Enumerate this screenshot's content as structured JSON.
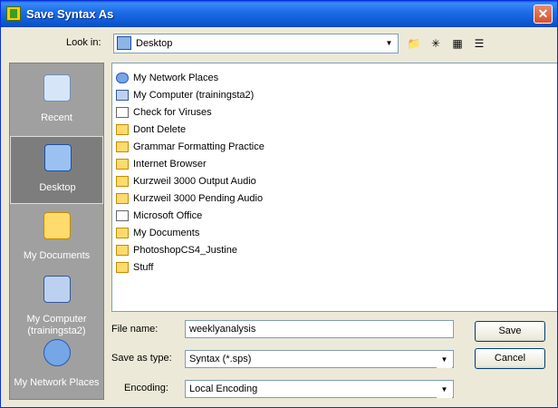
{
  "window": {
    "title": "Save Syntax As",
    "close_label": "✕"
  },
  "lookin": {
    "label": "Look in:",
    "value": "Desktop"
  },
  "places": [
    {
      "label": "Recent"
    },
    {
      "label": "Desktop"
    },
    {
      "label": "My Documents"
    },
    {
      "label": "My Computer (trainingsta2)"
    },
    {
      "label": "My Network Places"
    }
  ],
  "files": [
    {
      "name": "My Network Places",
      "icon": "network-icon"
    },
    {
      "name": "My Computer (trainingsta2)",
      "icon": "computer-icon"
    },
    {
      "name": "Check for Viruses",
      "icon": "app-icon"
    },
    {
      "name": "Dont Delete",
      "icon": "folder-icon"
    },
    {
      "name": "Grammar Formatting Practice",
      "icon": "folder-icon"
    },
    {
      "name": "Internet Browser",
      "icon": "folder-icon"
    },
    {
      "name": "Kurzweil 3000 Output Audio",
      "icon": "shortcut-icon"
    },
    {
      "name": "Kurzweil 3000 Pending Audio",
      "icon": "shortcut-icon"
    },
    {
      "name": "Microsoft Office",
      "icon": "shortcut-icon"
    },
    {
      "name": "My Documents",
      "icon": "folder-icon"
    },
    {
      "name": "PhotoshopCS4_Justine",
      "icon": "folder-icon"
    },
    {
      "name": "Stuff",
      "icon": "folder-icon"
    }
  ],
  "form": {
    "filename_label": "File name:",
    "filename_value": "weeklyanalysis",
    "savetype_label": "Save as type:",
    "savetype_value": "Syntax (*.sps)",
    "encoding_label": "Encoding:",
    "encoding_value": "Local Encoding"
  },
  "buttons": {
    "save": "Save",
    "cancel": "Cancel"
  }
}
